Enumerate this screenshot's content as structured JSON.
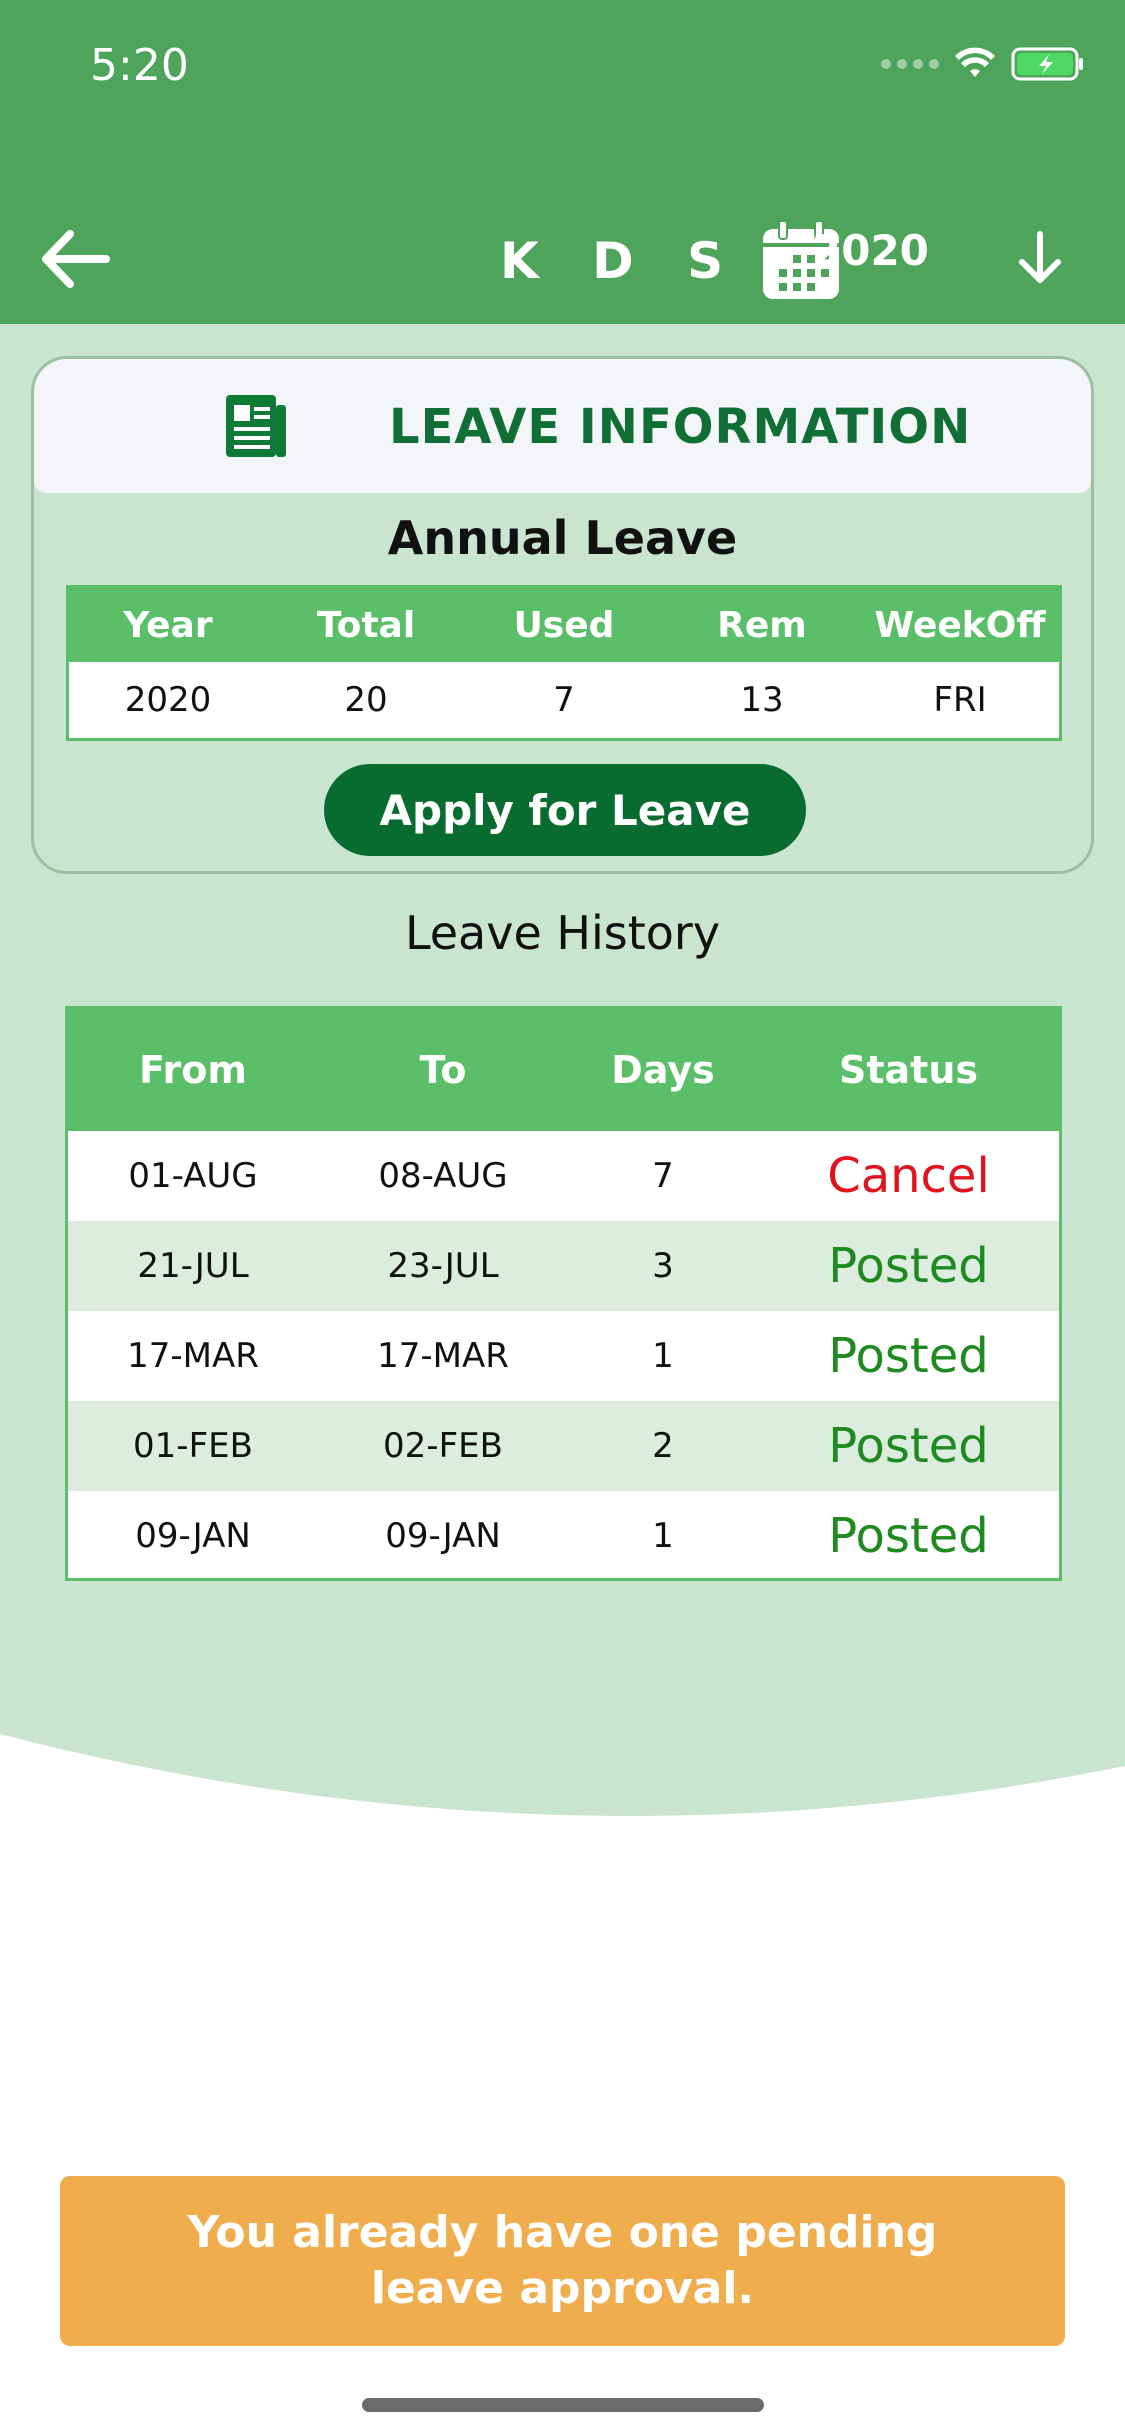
{
  "status_bar": {
    "time": "5:20"
  },
  "header": {
    "title": "K D S",
    "year": "2020",
    "icons": [
      "back-arrow-icon",
      "calendar-icon",
      "down-arrow-icon"
    ]
  },
  "leave_info": {
    "title": "LEAVE INFORMATION",
    "subtitle": "Annual Leave",
    "columns": [
      "Year",
      "Total",
      "Used",
      "Rem",
      "WeekOff"
    ],
    "values": [
      "2020",
      "20",
      "7",
      "13",
      "FRI"
    ],
    "apply_label": "Apply for Leave"
  },
  "history": {
    "title": "Leave History",
    "columns": [
      "From",
      "To",
      "Days",
      "Status"
    ],
    "rows": [
      {
        "from": "01-AUG",
        "to": "08-AUG",
        "days": "7",
        "status": "Cancel"
      },
      {
        "from": "21-JUL",
        "to": "23-JUL",
        "days": "3",
        "status": "Posted"
      },
      {
        "from": "17-MAR",
        "to": "17-MAR",
        "days": "1",
        "status": "Posted"
      },
      {
        "from": "01-FEB",
        "to": "02-FEB",
        "days": "2",
        "status": "Posted"
      },
      {
        "from": "09-JAN",
        "to": "09-JAN",
        "days": "1",
        "status": "Posted"
      }
    ]
  },
  "toast": {
    "message": "You already have one pending leave approval."
  },
  "colors": {
    "header_green": "#4da45a",
    "table_green": "#5bbf6a",
    "dark_green": "#086c30",
    "status_posted": "#1f8a1f",
    "status_cancel": "#e0141e",
    "toast_orange": "#f0ad4e"
  }
}
